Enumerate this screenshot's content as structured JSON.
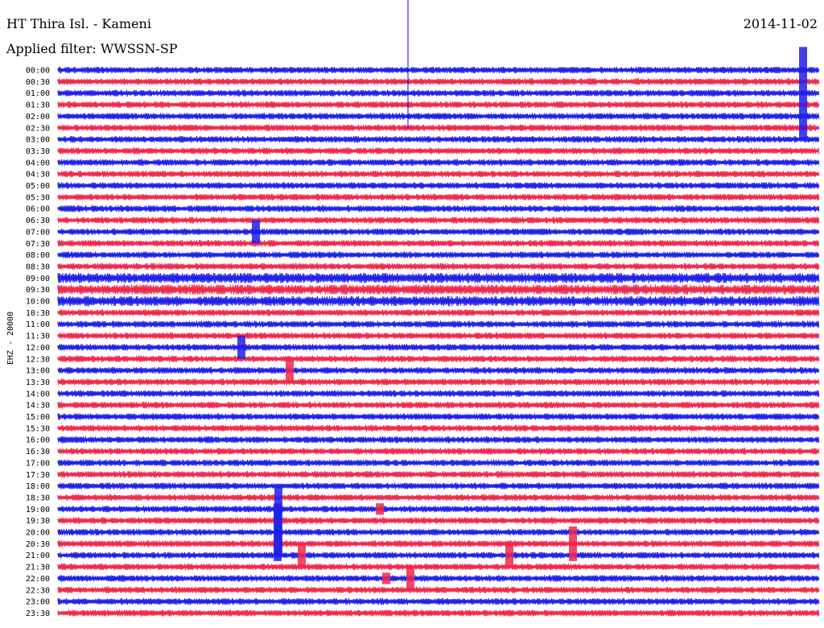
{
  "header": {
    "station": "HT Thira Isl. - Kameni",
    "filter": "Applied filter: WWSSN-SP",
    "date": "2014-11-02",
    "channel_label": "EHZ - 20000"
  },
  "colors": {
    "trace_a": "#2020e8",
    "trace_b": "#f0284c",
    "marker": "#0000ff"
  },
  "chart_data": {
    "type": "line",
    "title": "HT Thira Isl. - Kameni",
    "subtitle": "Applied filter: WWSSN-SP",
    "ylabel": "EHZ - 20000",
    "row_labels": [
      "00:00",
      "00:30",
      "01:00",
      "01:30",
      "02:00",
      "02:30",
      "03:00",
      "03:30",
      "04:00",
      "04:30",
      "05:00",
      "05:30",
      "06:00",
      "06:30",
      "07:00",
      "07:30",
      "08:00",
      "08:30",
      "09:00",
      "09:30",
      "10:00",
      "10:30",
      "11:00",
      "11:30",
      "12:00",
      "12:30",
      "13:00",
      "13:30",
      "14:00",
      "14:30",
      "15:00",
      "15:30",
      "16:00",
      "16:30",
      "17:00",
      "17:30",
      "18:00",
      "18:30",
      "19:00",
      "19:30",
      "20:00",
      "20:30",
      "21:00",
      "21:30",
      "22:00",
      "22:30",
      "23:00",
      "23:30"
    ],
    "series_colors": [
      "#2020e8",
      "#f0284c"
    ]
  }
}
